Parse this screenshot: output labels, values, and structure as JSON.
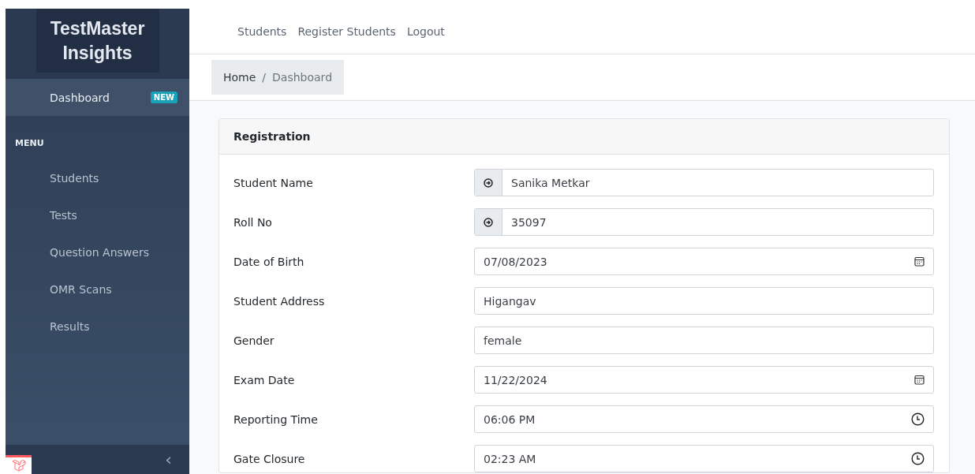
{
  "sidebar": {
    "brand": "TestMaster Insights",
    "items": [
      {
        "label": "Dashboard",
        "selected": true,
        "badge": "NEW"
      }
    ],
    "section_title": "MENU",
    "menu": [
      {
        "label": "Students",
        "selected": false
      },
      {
        "label": "Tests",
        "selected": false
      },
      {
        "label": "Question Answers",
        "selected": false
      },
      {
        "label": "OMR Scans",
        "selected": false
      },
      {
        "label": "Results",
        "selected": false
      }
    ],
    "toggle": "‹"
  },
  "top_nav": [
    "Students",
    "Register Students",
    "Logout"
  ],
  "breadcrumb": [
    "Home",
    "Dashboard"
  ],
  "breadcrumb_separator": "/",
  "card": {
    "title": "Registration",
    "fields": [
      {
        "label": "Student Name",
        "kind": "addon",
        "value": "Sanika Metkar"
      },
      {
        "label": "Roll No",
        "kind": "addon",
        "value": "35097"
      },
      {
        "label": "Date of Birth",
        "kind": "date",
        "value": "07/08/2023"
      },
      {
        "label": "Student Address",
        "kind": "text",
        "value": "Higangav"
      },
      {
        "label": "Gender",
        "kind": "text",
        "value": "female"
      },
      {
        "label": "Exam Date",
        "kind": "date",
        "value": "11/22/2024"
      },
      {
        "label": "Reporting Time",
        "kind": "time",
        "value": "06:06 PM"
      },
      {
        "label": "Gate Closure",
        "kind": "time",
        "value": "02:23 AM"
      }
    ]
  }
}
